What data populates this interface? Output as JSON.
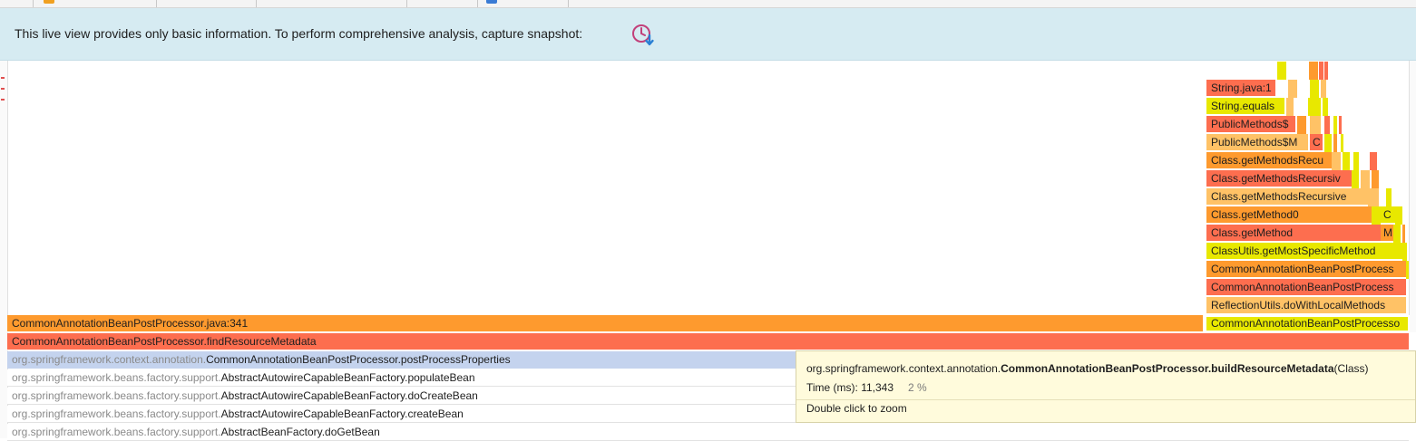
{
  "banner": {
    "text": "This live view provides only basic information. To perform comprehensive analysis, capture snapshot:",
    "icon": "capture-snapshot-icon"
  },
  "colors": {
    "orange": "#fe9a2e",
    "red_orange": "#fd6e4f",
    "light_orange": "#ffc266",
    "yellow": "#e8e800",
    "selected": "#c4d3ee",
    "banner_bg": "#d6ebf2",
    "tooltip_bg": "#fffbdc"
  },
  "flame": {
    "bottom_frames": [
      {
        "pkg": "",
        "name": "CommonAnnotationBeanPostProcessor.java:341",
        "color": "orange"
      },
      {
        "pkg": "",
        "name": "CommonAnnotationBeanPostProcessor.findResourceMetadata",
        "color": "red_orange"
      },
      {
        "pkg": "org.springframework.context.annotation.",
        "name": "CommonAnnotationBeanPostProcessor.postProcessProperties",
        "color": "selected"
      },
      {
        "pkg": "org.springframework.beans.factory.support.",
        "name": "AbstractAutowireCapableBeanFactory.populateBean",
        "color": "white"
      },
      {
        "pkg": "org.springframework.beans.factory.support.",
        "name": "AbstractAutowireCapableBeanFactory.doCreateBean",
        "color": "white"
      },
      {
        "pkg": "org.springframework.beans.factory.support.",
        "name": "AbstractAutowireCapableBeanFactory.createBean",
        "color": "white"
      },
      {
        "pkg": "org.springframework.beans.factory.support.",
        "name": "AbstractBeanFactory.doGetBean",
        "color": "white"
      }
    ],
    "right_stack": [
      {
        "name": "String.java:1",
        "color": "red_orange"
      },
      {
        "name": "String.equals",
        "color": "yellow"
      },
      {
        "name": "PublicMethods$",
        "color": "red_orange"
      },
      {
        "name": "PublicMethods$M",
        "color": "light_orange"
      },
      {
        "name": "Class.getMethodsRecu",
        "color": "orange"
      },
      {
        "name": "Class.getMethodsRecursiv",
        "color": "red_orange"
      },
      {
        "name": "Class.getMethodsRecursive",
        "color": "light_orange"
      },
      {
        "name": "Class.getMethod0",
        "color": "orange"
      },
      {
        "name": "Class.getMethod",
        "color": "red_orange"
      },
      {
        "name": "ClassUtils.getMostSpecificMethod",
        "color": "yellow"
      },
      {
        "name": "CommonAnnotationBeanPostProcess",
        "color": "orange"
      },
      {
        "name": "CommonAnnotationBeanPostProcess",
        "color": "red_orange"
      },
      {
        "name": "ReflectionUtils.doWithLocalMethods",
        "color": "light_orange"
      },
      {
        "name": "CommonAnnotationBeanPostProcesso",
        "color": "yellow"
      }
    ],
    "side_labels": [
      {
        "name": "C",
        "color": "red_orange"
      },
      {
        "name": "C",
        "color": "yellow"
      },
      {
        "name": "M",
        "color": "orange"
      }
    ]
  },
  "tooltip": {
    "package": "org.springframework.context.annotation.",
    "method": "CommonAnnotationBeanPostProcessor.buildResourceMetadata",
    "suffix": "(Class)",
    "time_label": "Time (ms): 11,343",
    "percent": "2 %",
    "hint": "Double click to zoom"
  }
}
